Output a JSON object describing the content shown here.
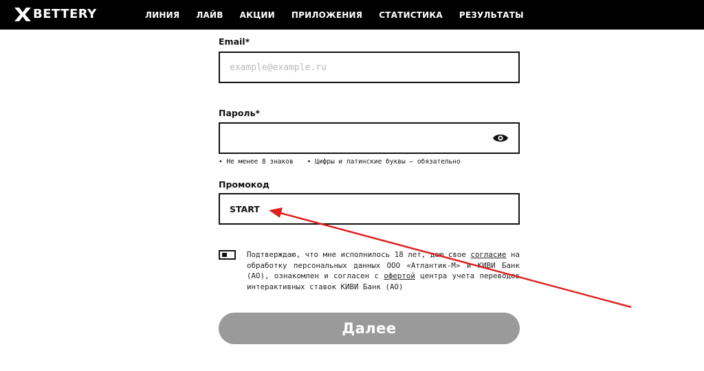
{
  "header": {
    "brand": "BETTERY",
    "nav": [
      {
        "label": "ЛИНИЯ"
      },
      {
        "label": "ЛАЙВ"
      },
      {
        "label": "АКЦИИ"
      },
      {
        "label": "ПРИЛОЖЕНИЯ"
      },
      {
        "label": "СТАТИСТИКА"
      },
      {
        "label": "РЕЗУЛЬТАТЫ"
      }
    ]
  },
  "form": {
    "email": {
      "label": "Email*",
      "placeholder": "example@example.ru",
      "value": ""
    },
    "password": {
      "label": "Пароль*",
      "value": "",
      "hints": [
        "• Не менее 8 знаков",
        "• Цифры и латинские буквы — обязательно"
      ]
    },
    "promo": {
      "label": "Промокод",
      "value": "START"
    },
    "consent": {
      "checked": true,
      "text_1": "Подтверждаю, что мне исполнилось 18 лет, даю свое ",
      "link_1": "согласие",
      "text_2": " на обработку персональных данных ООО «Атлантик-М» и КИВИ Банк (АО), ознакомлен и согласен с ",
      "link_2": "офертой",
      "text_3": " центра учета переводов интерактивных ставок КИВИ Банк (АО)"
    },
    "submit_label": "Далее"
  },
  "colors": {
    "header_bg": "#000000",
    "submit_disabled": "#9a9a9a",
    "annotation_arrow": "#e02020"
  }
}
